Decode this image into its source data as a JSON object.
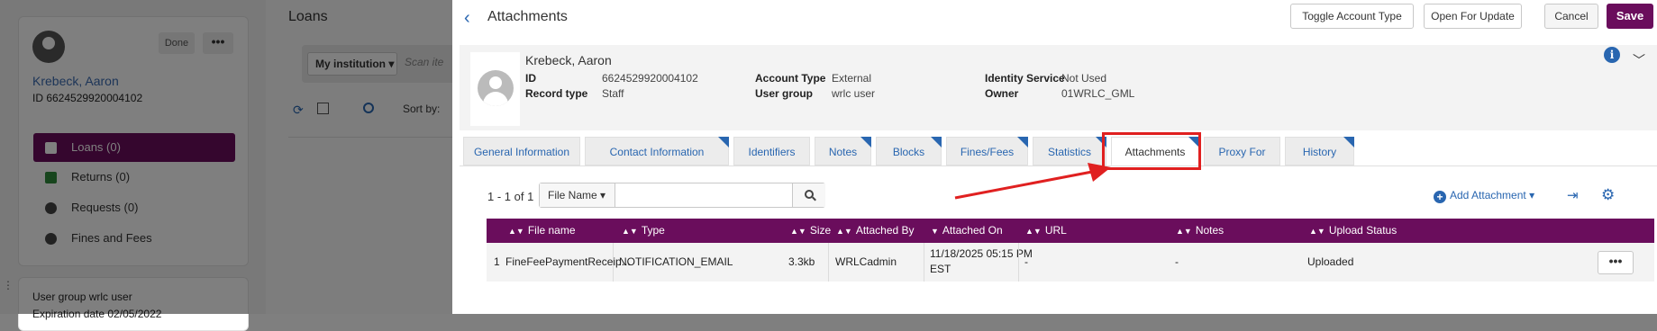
{
  "background": {
    "done_label": "Done",
    "more_label": "•••",
    "user_name": "Krebeck, Aaron",
    "user_id": "ID 6624529920004102",
    "nav": {
      "loans": "Loans  (0)",
      "returns": "Returns  (0)",
      "requests": "Requests  (0)",
      "fines": "Fines and Fees"
    },
    "user_group": "User group wrlc user",
    "expiration": "Expiration date 02/05/2022",
    "loans_title": "Loans",
    "institution_select": "My institution",
    "scan_placeholder": "Scan ite",
    "sort_by": "Sort by:"
  },
  "panel": {
    "title": "Attachments",
    "buttons": {
      "toggle": "Toggle Account Type",
      "open": "Open For Update",
      "cancel": "Cancel",
      "save": "Save"
    },
    "user": {
      "name": "Krebeck, Aaron",
      "fields": {
        "id_label": "ID",
        "id_value": "6624529920004102",
        "record_type_label": "Record type",
        "record_type_value": "Staff",
        "account_type_label": "Account Type",
        "account_type_value": "External",
        "user_group_label": "User group",
        "user_group_value": "wrlc user",
        "identity_label": "Identity Service",
        "identity_value": "Not Used",
        "owner_label": "Owner",
        "owner_value": "01WRLC_GML"
      }
    },
    "tabs": [
      "General Information",
      "Contact Information",
      "Identifiers",
      "Notes",
      "Blocks",
      "Fines/Fees",
      "Statistics",
      "Attachments",
      "Proxy For",
      "History"
    ],
    "active_tab": "Attachments",
    "list": {
      "count": "1 - 1 of 1",
      "search_field": "File Name",
      "search_value": "",
      "add_label": "Add Attachment",
      "columns": [
        "File name",
        "Type",
        "Size",
        "Attached By",
        "Attached On",
        "URL",
        "Notes",
        "Upload Status"
      ],
      "rows": [
        {
          "index": "1",
          "file_name": "FineFeePaymentReceip...",
          "type": "NOTIFICATION_EMAIL",
          "size": "3.3kb",
          "attached_by": "WRLCadmin",
          "attached_on": "11/18/2025 05:15 PM EST",
          "url": "-",
          "notes": "-",
          "upload_status": "Uploaded",
          "menu_label": "•••"
        }
      ]
    }
  },
  "colors": {
    "brand": "#6a0d5c",
    "link": "#2966b0",
    "annotation": "#e02020"
  }
}
